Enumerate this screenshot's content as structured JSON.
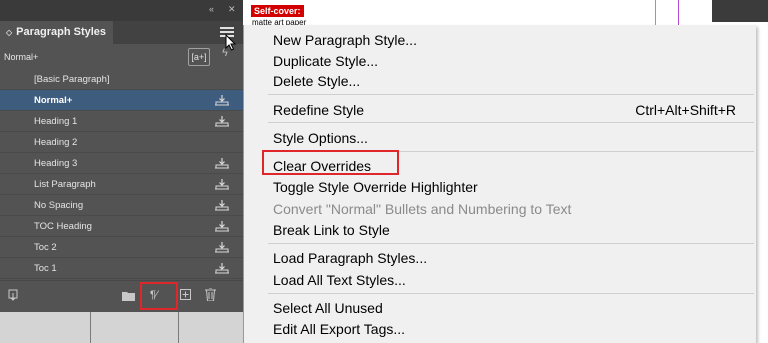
{
  "document": {
    "label_red": "Self-cover:",
    "label_text": "matte art paper"
  },
  "panel": {
    "title": "Paragraph Styles",
    "current_style": "Normal+",
    "new_style_group_label": "[a+]",
    "styles": [
      {
        "label": "[Basic Paragraph]",
        "selected": false,
        "sync": false
      },
      {
        "label": "Normal+",
        "selected": true,
        "sync": true
      },
      {
        "label": "Heading 1",
        "selected": false,
        "sync": true
      },
      {
        "label": "Heading 2",
        "selected": false,
        "sync": false
      },
      {
        "label": "Heading 3",
        "selected": false,
        "sync": true
      },
      {
        "label": "List Paragraph",
        "selected": false,
        "sync": true
      },
      {
        "label": "No Spacing",
        "selected": false,
        "sync": true
      },
      {
        "label": "TOC Heading",
        "selected": false,
        "sync": true
      },
      {
        "label": "Toc 2",
        "selected": false,
        "sync": true
      },
      {
        "label": "Toc 1",
        "selected": false,
        "sync": true
      }
    ],
    "bottom_icons": [
      "load-styles-icon",
      "folder-icon",
      "clear-overrides-icon",
      "new-style-icon",
      "trash-icon"
    ],
    "highlight_color": "#e0262b",
    "selected_row_color": "#3e5c7e"
  },
  "menu": {
    "items": [
      {
        "label": "New Paragraph Style...",
        "disabled": false
      },
      {
        "label": "Duplicate Style...",
        "disabled": false
      },
      {
        "label": "Delete Style...",
        "disabled": false
      },
      {
        "label": "Redefine Style",
        "shortcut": "Ctrl+Alt+Shift+R",
        "disabled": false
      },
      {
        "label": "Style Options...",
        "disabled": false
      },
      {
        "label": "Clear Overrides",
        "disabled": false,
        "highlighted": true
      },
      {
        "label": "Toggle Style Override Highlighter",
        "disabled": false
      },
      {
        "label": "Convert \"Normal\" Bullets and Numbering to Text",
        "disabled": true
      },
      {
        "label": "Break Link to Style",
        "disabled": false
      },
      {
        "label": "Load Paragraph Styles...",
        "disabled": false
      },
      {
        "label": "Load All Text Styles...",
        "disabled": false
      },
      {
        "label": "Select All Unused",
        "disabled": false
      },
      {
        "label": "Edit All Export Tags...",
        "disabled": false
      }
    ]
  }
}
